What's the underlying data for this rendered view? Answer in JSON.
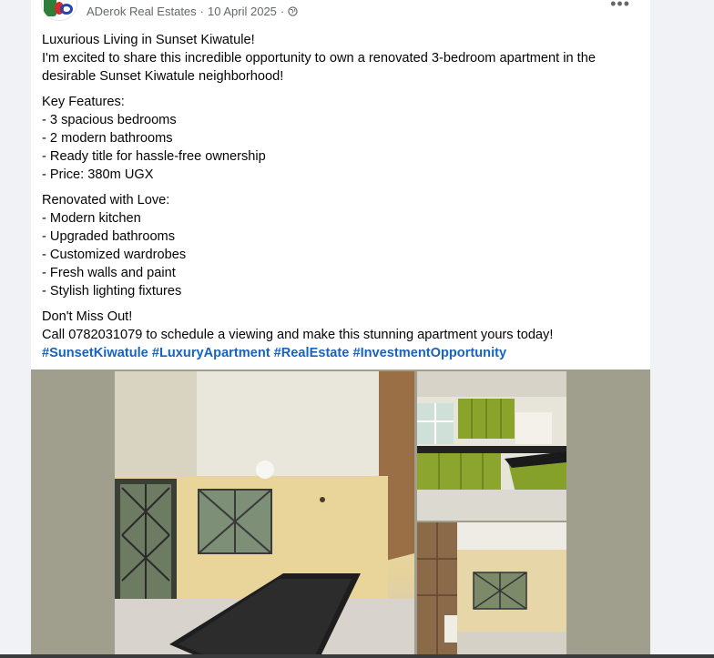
{
  "post": {
    "author": "ADerok Real Estates",
    "separator": "·",
    "date": "10 April 2025",
    "more_icon": "more-horizontal-icon",
    "privacy_icon": "globe-icon"
  },
  "body": {
    "headline": "Luxurious Living in Sunset Kiwatule!",
    "intro": "I'm excited to share this incredible opportunity to own a renovated 3-bedroom apartment in the desirable Sunset Kiwatule neighborhood!",
    "key_features_title": "Key Features:",
    "key_features": [
      "- 3 spacious bedrooms",
      "- 2 modern bathrooms",
      "- Ready title for hassle-free ownership",
      "- Price: 380m UGX"
    ],
    "renovated_title": "Renovated with Love:",
    "renovated": [
      "- Modern kitchen",
      "- Upgraded bathrooms",
      "- Customized wardrobes",
      "- Fresh walls and paint",
      "- Stylish lighting fixtures"
    ],
    "cta_title": "Don't Miss Out!",
    "cta": "Call 0782031079 to schedule a viewing and make this stunning apartment yours today!",
    "hashtags": [
      "#SunsetKiwatule",
      "#LuxuryApartment",
      "#RealEstate",
      "#InvestmentOpportunity"
    ]
  },
  "colors": {
    "hashtag": "#1764c0",
    "meta": "#65676b",
    "text": "#050505",
    "media_bg": "#a09f8d"
  }
}
